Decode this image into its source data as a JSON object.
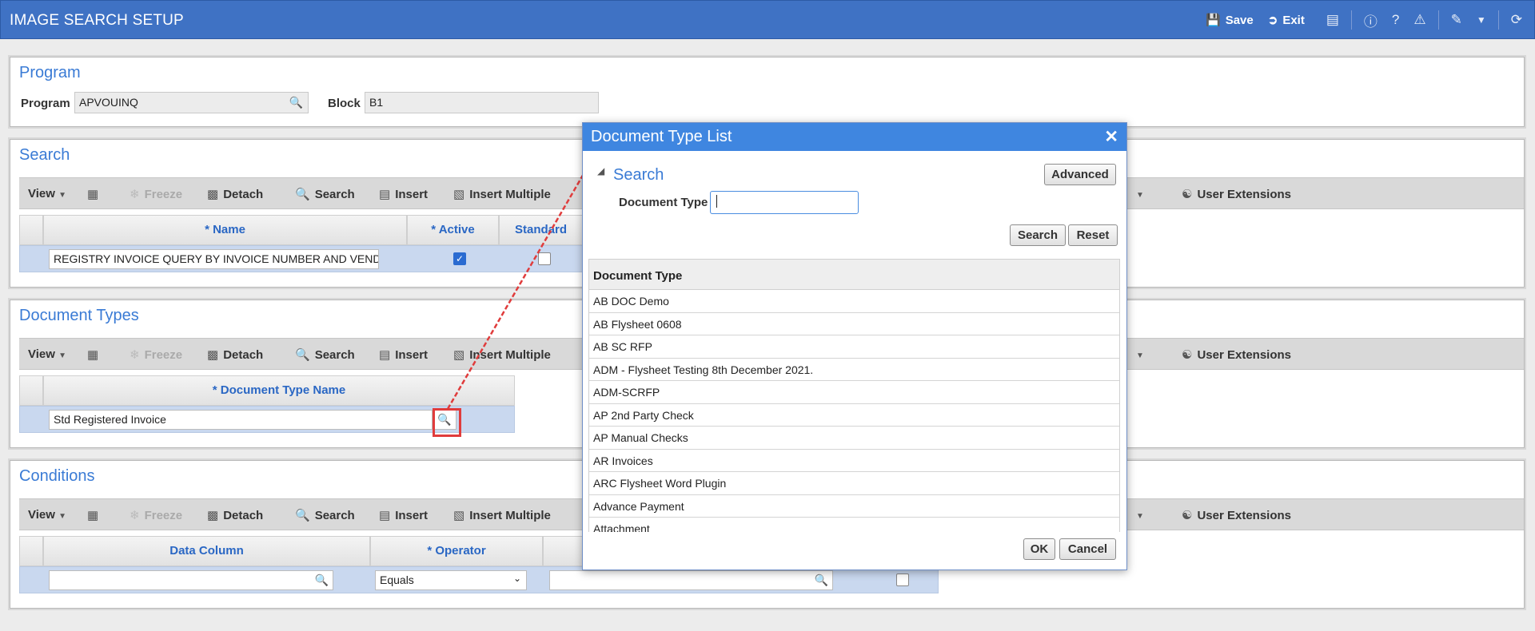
{
  "app": {
    "title": "IMAGE SEARCH SETUP",
    "save_label": "Save",
    "exit_label": "Exit"
  },
  "program_panel": {
    "title": "Program",
    "program_label": "Program",
    "program_value": "APVOUINQ",
    "block_label": "Block",
    "block_value": "B1"
  },
  "toolbar": {
    "view": "View",
    "freeze": "Freeze",
    "detach": "Detach",
    "search": "Search",
    "insert": "Insert",
    "insert_multiple": "Insert Multiple",
    "user_extensions": "User Extensions"
  },
  "search_panel": {
    "title": "Search",
    "columns": [
      "* Name",
      "* Active",
      "Standard"
    ],
    "row": {
      "name": "REGISTRY INVOICE QUERY BY INVOICE NUMBER AND VENDOR",
      "active": true,
      "standard": false
    }
  },
  "doc_types_panel": {
    "title": "Document Types",
    "column": "* Document Type Name",
    "row_value": "Std Registered Invoice"
  },
  "conditions_panel": {
    "title": "Conditions",
    "columns": [
      "Data Column",
      "* Operator"
    ],
    "operator_value": "Equals"
  },
  "dialog": {
    "title": "Document Type List",
    "section_title": "Search",
    "advanced_label": "Advanced",
    "field_label": "Document Type",
    "field_value": "",
    "search_btn": "Search",
    "reset_btn": "Reset",
    "list_header": "Document Type",
    "items": [
      "AB DOC Demo",
      "AB Flysheet 0608",
      "AB SC RFP",
      "ADM - Flysheet Testing 8th December 2021.",
      "ADM-SCRFP",
      "AP 2nd Party Check",
      "AP Manual Checks",
      "AR Invoices",
      "ARC Flysheet Word Plugin",
      "Advance Payment",
      "Attachment"
    ],
    "ok_label": "OK",
    "cancel_label": "Cancel"
  },
  "colors": {
    "titlebar": "#3f72c4",
    "dialog_title": "#3f86e0",
    "panel_title": "#3a7bd5",
    "selected_row": "#c9d8ef",
    "highlight_box": "#e03c3c"
  },
  "icons": [
    "save-icon",
    "exit-icon",
    "print-icon",
    "info-icon",
    "help-icon",
    "warning-icon",
    "edit-icon",
    "refresh-icon",
    "search-icon",
    "close-icon",
    "checkbox-icon"
  ]
}
